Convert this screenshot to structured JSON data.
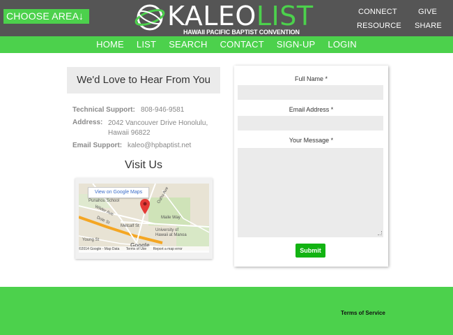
{
  "header": {
    "choose_area": "CHOOSE AREA",
    "choose_area_arrow": "↓",
    "logo_main": "KALEO",
    "logo_accent": "LIST",
    "logo_subtitle": "HAWAII PACIFIC BAPTIST CONVENTION",
    "links": {
      "connect": "CONNECT",
      "give": "GIVE",
      "resource": "RESOURCE",
      "share": "SHARE"
    }
  },
  "nav": {
    "items": [
      "HOME",
      "LIST",
      "SEARCH",
      "CONTACT",
      "SIGN-UP",
      "LOGIN"
    ]
  },
  "contact": {
    "heading": "We'd Love to Hear From You",
    "tech_label": "Technical Support:",
    "tech_value": "808-946-9581",
    "address_label": "Address:",
    "address_value": "2042 Vancouver Drive Honolulu, Hawaii 96822",
    "email_label": "Email Support:",
    "email_value": "kaleo@hpbaptist.net"
  },
  "visit": {
    "title": "Visit Us",
    "map_button": "View on Google Maps",
    "map_labels": {
      "punahou": "Punahou School",
      "wilder": "Wilder Ave",
      "metcalf": "Metcalf St",
      "dole": "Dole St",
      "maile": "Maile Way",
      "university": "University of",
      "manoa": "Hawaii at Manoa",
      "young": "Young St",
      "oahu": "Oahu Ave"
    },
    "watermark": "Google",
    "footer": {
      "copyright": "©2014 Google - Map Data",
      "terms": "Terms of Use",
      "report": "Report a map error"
    }
  },
  "form": {
    "name_label": "Full Name *",
    "email_label": "Email Address *",
    "message_label": "Your Message *",
    "submit": "Submit"
  },
  "footer": {
    "terms": "Terms of Service"
  },
  "colors": {
    "brand_green": "#4cd14c",
    "header_gray": "#555555",
    "submit_green": "#12b312"
  }
}
